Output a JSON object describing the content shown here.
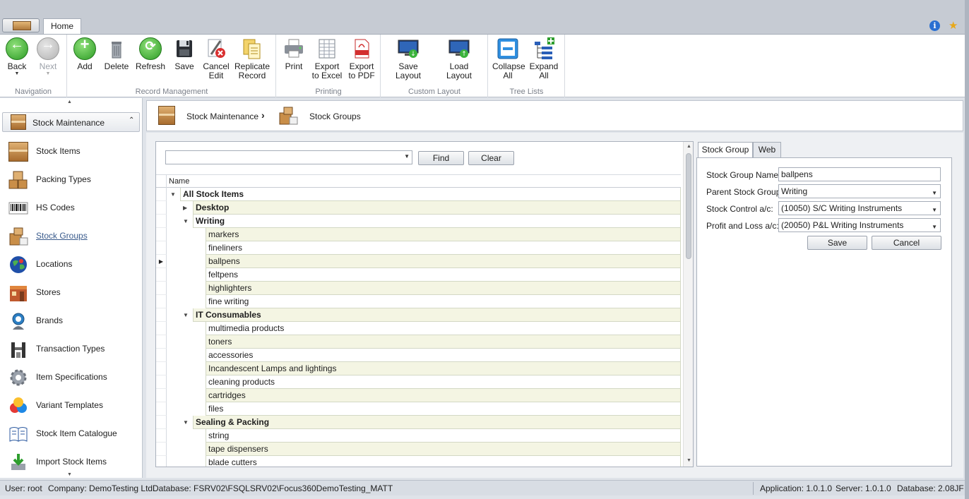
{
  "ribbon": {
    "tab_home": "Home",
    "groups": {
      "navigation": "Navigation",
      "record_management": "Record Management",
      "printing": "Printing",
      "custom_layout": "Custom Layout",
      "tree_lists": "Tree Lists"
    },
    "buttons": {
      "back": "Back",
      "next": "Next",
      "add": "Add",
      "delete": "Delete",
      "refresh": "Refresh",
      "save": "Save",
      "cancel_edit": "Cancel\nEdit",
      "replicate_record": "Replicate\nRecord",
      "print": "Print",
      "export_excel": "Export\nto Excel",
      "export_pdf": "Export\nto PDF",
      "save_layout": "Save Layout",
      "load_layout": "Load Layout",
      "collapse_all": "Collapse\nAll",
      "expand_all": "Expand\nAll"
    }
  },
  "sidebar": {
    "header": "Stock Maintenance",
    "items": [
      {
        "label": "Stock Items",
        "icon": "box-icon"
      },
      {
        "label": "Packing Types",
        "icon": "boxes-icon"
      },
      {
        "label": "HS Codes",
        "icon": "barcode-icon"
      },
      {
        "label": "Stock Groups",
        "icon": "box-group-icon"
      },
      {
        "label": "Locations",
        "icon": "globe-icon"
      },
      {
        "label": "Stores",
        "icon": "store-icon"
      },
      {
        "label": "Brands",
        "icon": "brand-icon"
      },
      {
        "label": "Transaction Types",
        "icon": "transaction-icon"
      },
      {
        "label": "Item Specifications",
        "icon": "gear-icon"
      },
      {
        "label": "Variant Templates",
        "icon": "color-balls-icon"
      },
      {
        "label": "Stock Item Catalogue",
        "icon": "book-icon"
      },
      {
        "label": "Import Stock Items",
        "icon": "import-icon"
      }
    ]
  },
  "breadcrumb": {
    "first": "Stock Maintenance",
    "separator": "›",
    "second": "Stock Groups"
  },
  "search": {
    "value": "",
    "find_label": "Find",
    "clear_label": "Clear"
  },
  "tree": {
    "column_name": "Name",
    "rows": [
      {
        "label": "All Stock Items",
        "level": 0,
        "bold": true,
        "expanded": true,
        "toggle": "collapse"
      },
      {
        "label": "Desktop",
        "level": 1,
        "bold": true,
        "toggle": "expand"
      },
      {
        "label": "Writing",
        "level": 1,
        "bold": true,
        "toggle": "collapse"
      },
      {
        "label": "markers",
        "level": 2
      },
      {
        "label": "fineliners",
        "level": 2
      },
      {
        "label": "ballpens",
        "level": 2,
        "selected": true
      },
      {
        "label": "feltpens",
        "level": 2
      },
      {
        "label": "highlighters",
        "level": 2
      },
      {
        "label": "fine writing",
        "level": 2
      },
      {
        "label": "IT Consumables",
        "level": 1,
        "bold": true,
        "toggle": "collapse"
      },
      {
        "label": "multimedia products",
        "level": 2
      },
      {
        "label": "toners",
        "level": 2
      },
      {
        "label": "accessories",
        "level": 2
      },
      {
        "label": "Incandescent Lamps and lightings",
        "level": 2
      },
      {
        "label": "cleaning products",
        "level": 2
      },
      {
        "label": "cartridges",
        "level": 2
      },
      {
        "label": "files",
        "level": 2
      },
      {
        "label": "Sealing & Packing",
        "level": 1,
        "bold": true,
        "toggle": "collapse"
      },
      {
        "label": "string",
        "level": 2
      },
      {
        "label": "tape dispensers",
        "level": 2
      },
      {
        "label": "blade cutters",
        "level": 2
      }
    ]
  },
  "detail": {
    "tabs": [
      "Stock Group",
      "Web"
    ],
    "stock_group_name_label": "Stock Group Name:",
    "stock_group_name_value": "ballpens",
    "parent_stock_group_label": "Parent Stock Group:",
    "parent_stock_group_value": "Writing",
    "stock_control_label": "Stock Control a/c:",
    "stock_control_value": "(10050) S/C Writing Instruments",
    "profit_loss_label": "Profit and Loss a/c:",
    "profit_loss_value": "(20050) P&L Writing Instruments",
    "save_label": "Save",
    "cancel_label": "Cancel"
  },
  "status": {
    "user": "User: root",
    "company": "Company: DemoTesting Ltd.",
    "database": "Database: FSRV02\\FSQLSRV02\\Focus360DemoTesting_MATT",
    "application": "Application: 1.0.1.0",
    "server": "Server: 1.0.1.0",
    "database_version": "Database: 2.08JF"
  },
  "colors": {
    "row_alt": "#f4f5e3",
    "accent_green": "#2d9c25",
    "link_blue": "#3a5b8c"
  }
}
